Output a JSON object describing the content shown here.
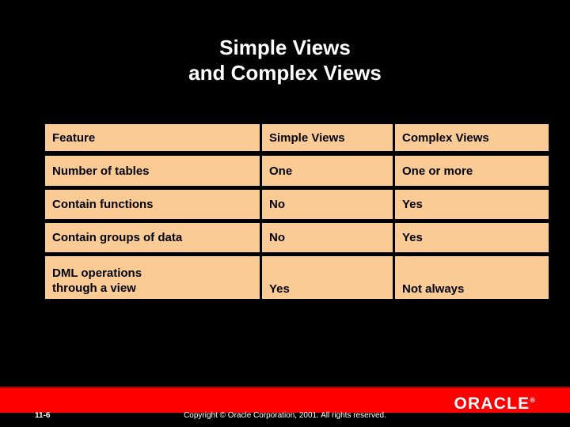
{
  "slide": {
    "background_color": "#000000",
    "title_lines": [
      "Simple Views",
      "and Complex Views"
    ]
  },
  "table": {
    "accent_color": "#fbcb96",
    "text_color": "#000000",
    "headers": [
      "Feature",
      "Simple Views",
      "Complex Views"
    ],
    "rows": [
      {
        "feature": "Number of tables",
        "simple": "One",
        "complex": "One or more"
      },
      {
        "feature": "Contain functions",
        "simple": "No",
        "complex": "Yes"
      },
      {
        "feature": "Contain groups of data",
        "simple": "No",
        "complex": "Yes"
      },
      {
        "feature": "DML operations\nthrough  a view",
        "simple": "Yes",
        "complex": "Not always"
      }
    ]
  },
  "footer": {
    "bar_color": "#ff0000",
    "logo_text": "ORACLE",
    "logo_trademark": "®",
    "page_number": "11-6",
    "copyright": "Copyright © Oracle Corporation, 2001. All rights reserved."
  }
}
